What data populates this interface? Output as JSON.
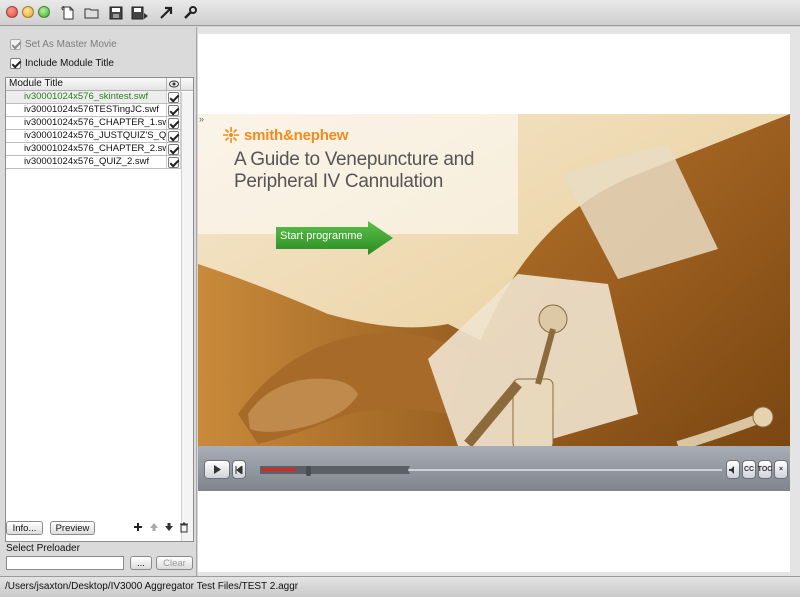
{
  "window": {
    "toolbar_icons": [
      "new-document-icon",
      "open-folder-icon",
      "save-icon",
      "save-as-icon",
      "publish-arrow-icon",
      "wrench-icon"
    ]
  },
  "options": {
    "set_master_label": "Set As Master Movie",
    "set_master_checked": true,
    "set_master_enabled": false,
    "include_title_label": "Include Module Title",
    "include_title_checked": true
  },
  "modules": {
    "column_title": "Module Title",
    "column_icon": "eye-icon",
    "rows": [
      {
        "title": "iv30001024x576_skintest.swf",
        "visible": true,
        "selected": true
      },
      {
        "title": "iv30001024x576TESTingJC.swf",
        "visible": true,
        "selected": false
      },
      {
        "title": "iv30001024x576_CHAPTER_1.swf",
        "visible": true,
        "selected": false
      },
      {
        "title": "iv30001024x576_JUSTQUIZ'S_Q...",
        "visible": true,
        "selected": false
      },
      {
        "title": "iv30001024x576_CHAPTER_2.swf",
        "visible": true,
        "selected": false
      },
      {
        "title": "iv30001024x576_QUIZ_2.swf",
        "visible": true,
        "selected": false
      }
    ]
  },
  "actions": {
    "info_label": "Info...",
    "preview_label": "Preview",
    "icons": [
      "add-icon",
      "move-up-icon",
      "move-down-icon",
      "trash-icon"
    ]
  },
  "preloader": {
    "label": "Select Preloader",
    "value": "",
    "browse_label": "...",
    "clear_label": "Clear"
  },
  "preview": {
    "collapse_glyph": "»",
    "brand": "smith&nephew",
    "headline_line1": "A Guide to Venepuncture and",
    "headline_line2": "Peripheral IV Cannulation",
    "start_label": "Start programme",
    "player_labels": {
      "cc": "CC",
      "toc": "TOC",
      "close": "×"
    },
    "colors": {
      "brand_orange": "#f28b1c",
      "photo_tint": "#c98a2a",
      "start_green": "#3aa22e"
    }
  },
  "status": {
    "path": "/Users/jsaxton/Desktop/IV3000 Aggregator Test Files/TEST 2.aggr"
  }
}
